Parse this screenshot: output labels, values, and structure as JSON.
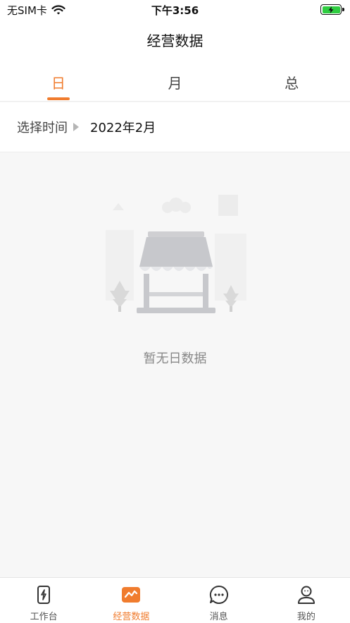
{
  "status_bar": {
    "carrier": "无SIM卡",
    "time": "下午3:56",
    "wifi_icon": "wifi-icon",
    "battery_icon": "battery-charging-icon"
  },
  "nav": {
    "title": "经营数据"
  },
  "tabs": [
    {
      "label": "日",
      "active": true
    },
    {
      "label": "月",
      "active": false
    },
    {
      "label": "总",
      "active": false
    }
  ],
  "time_select": {
    "label": "选择时间",
    "value": "2022年2月",
    "icon": "triangle-right-icon"
  },
  "empty_state": {
    "text": "暂无日数据",
    "illustration": "empty-store-icon"
  },
  "tabbar": [
    {
      "label": "工作台",
      "icon": "workbench-icon",
      "active": false
    },
    {
      "label": "经营数据",
      "icon": "chart-icon",
      "active": true
    },
    {
      "label": "消息",
      "icon": "message-icon",
      "active": false
    },
    {
      "label": "我的",
      "icon": "profile-icon",
      "active": false
    }
  ],
  "colors": {
    "accent": "#f07c2e",
    "battery": "#2ecc40",
    "background": "#f7f7f7"
  }
}
